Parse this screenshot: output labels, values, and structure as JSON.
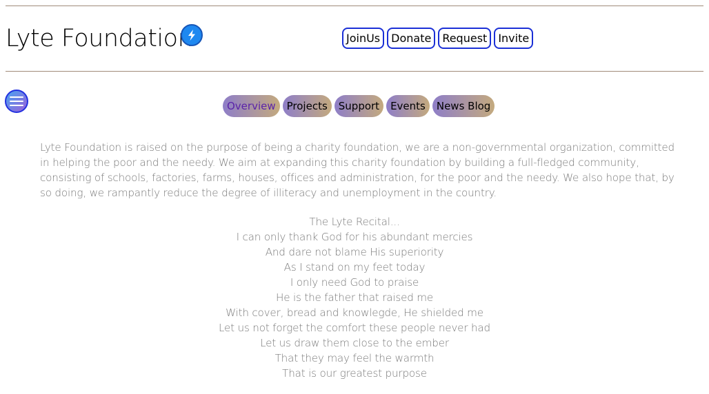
{
  "header": {
    "title": "Lyte Foundation",
    "badge_icon": "lightning-bolt-icon",
    "actions": [
      "JoinUs",
      "Donate",
      "Request",
      "Invite"
    ]
  },
  "menu": {
    "icon": "hamburger-menu-icon"
  },
  "nav": {
    "tabs": [
      {
        "label": "Overview",
        "active": true
      },
      {
        "label": "Projects",
        "active": false
      },
      {
        "label": "Support",
        "active": false
      },
      {
        "label": "Events",
        "active": false
      },
      {
        "label": "News Blog",
        "active": false
      }
    ]
  },
  "content": {
    "intro": "Lyte Foundation is raised on the purpose of being a charity foundation, we are a non-governmental organization, committed in helping the poor and the needy. We aim at expanding this charity foundation by building a full-fledged community, consisting of schools, factories, farms, houses, offices and administration, for the poor and the needy. We also hope that, by so doing, we rampantly reduce the degree of illiteracy and unemployment in the country.",
    "poem": [
      "The Lyte Recital...",
      "I can only thank God for his abundant mercies",
      "And dare not blame His superiority",
      "As I stand on my feet today",
      "I only need God to praise",
      "He is the father that raised me",
      "With cover, bread and knowlegde, He shielded me",
      "Let us not forget the comfort these people never had",
      "Let us draw them close to the ember",
      "That they may feel the warmth",
      "That is our greatest purpose"
    ]
  },
  "colors": {
    "rule": "#a08a78",
    "button_border": "#1a2fd6",
    "tab_gradient_start": "#8e7ec8",
    "tab_gradient_end": "#c4aa7e",
    "active_tab_text": "#5a23a8",
    "body_text": "#7b7b7b",
    "bolt_fill": "#1e88f0"
  }
}
